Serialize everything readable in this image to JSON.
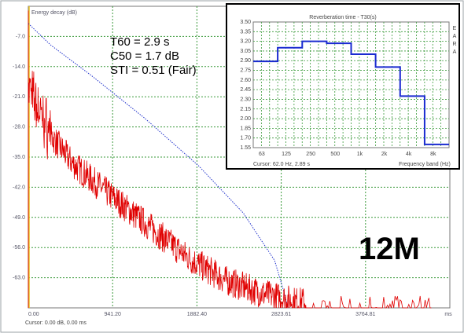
{
  "main_chart": {
    "ylabel": "Energy decay (dB)",
    "y_ticks": [
      "-7.0",
      "-14.0",
      "-21.0",
      "-28.0",
      "-35.0",
      "-42.0",
      "-49.0",
      "-56.0",
      "-63.0"
    ],
    "x_ticks": [
      "0.00",
      "941.20",
      "1882.40",
      "2823.61",
      "3764.81",
      "ms"
    ],
    "cursor_text": "Cursor:  0.00 dB,  0.00 ms",
    "annotations": {
      "t60": "T60 = 2.9 s",
      "c50": "C50 = 1.7 dB",
      "sti": "STI = 0.51 (Fair)"
    },
    "label_12m": "12M",
    "colors": {
      "decay": "#e00000",
      "schroeder": "#2233cc",
      "grid": "#3a9a3a",
      "onset": "#e8c020"
    }
  },
  "inset_chart": {
    "title": "Reverberation time - T30(s)",
    "y_ticks": [
      "3.50",
      "3.35",
      "3.20",
      "3.05",
      "2.90",
      "2.75",
      "2.60",
      "2.45",
      "2.30",
      "2.15",
      "2.00",
      "1.85",
      "1.70",
      "1.55"
    ],
    "x_ticks": [
      "63",
      "125",
      "250",
      "500",
      "1k",
      "2k",
      "4k",
      "8k"
    ],
    "xlabel": "Frequency band (Hz)",
    "cursor_text": "Cursor:  62.0 Hz, 2.89 s",
    "side_letters": [
      "E",
      "A",
      "R",
      "A"
    ]
  },
  "chart_data": [
    {
      "type": "line",
      "title": "",
      "ylabel": "Energy decay (dB)",
      "xlabel": "",
      "ylim": [
        -70,
        0
      ],
      "xlim": [
        0,
        4706
      ],
      "x_unit": "ms",
      "series": [
        {
          "x": [
            0,
            250,
            700,
            1300,
            1900,
            2400,
            2750,
            2850,
            2900
          ],
          "y": [
            -4,
            -9,
            -16,
            -26,
            -37,
            -48,
            -59,
            -66,
            -70
          ]
        },
        {
          "x": [
            0,
            60,
            200,
            500,
            900,
            1200,
            1500,
            1800,
            2200,
            2600,
            3000,
            4600
          ],
          "y": [
            -20,
            -24,
            -30,
            -38,
            -45,
            -50,
            -55,
            -60,
            -65,
            -68,
            -70,
            -70
          ]
        }
      ],
      "grid": true
    },
    {
      "type": "line",
      "title": "Reverberation time - T30(s)",
      "xlabel": "Frequency band (Hz)",
      "ylabel": "",
      "categories": [
        "63",
        "125",
        "250",
        "500",
        "1k",
        "2k",
        "4k",
        "8k"
      ],
      "values": [
        2.89,
        3.1,
        3.2,
        3.17,
        3.0,
        2.8,
        2.35,
        1.6
      ],
      "ylim": [
        1.55,
        3.5
      ],
      "grid": true
    }
  ]
}
